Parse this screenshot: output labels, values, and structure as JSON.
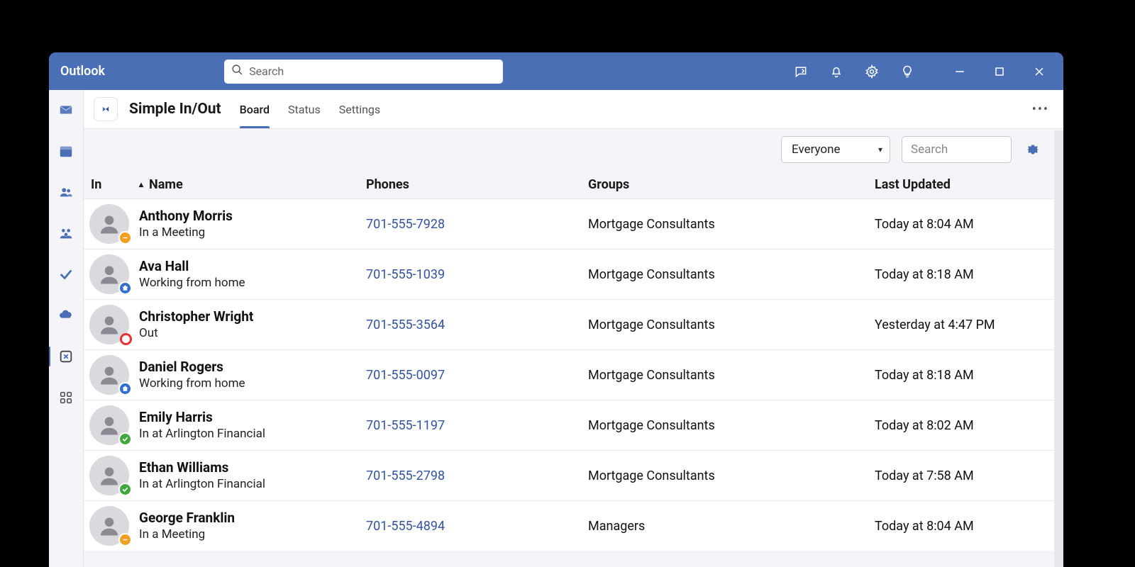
{
  "window": {
    "app_title": "Outlook",
    "search_placeholder": "Search"
  },
  "titlebar_icons": [
    "chat-icon",
    "bell-icon",
    "settings-gear-icon",
    "lightbulb-icon",
    "minimize-icon",
    "maximize-icon",
    "close-icon"
  ],
  "rail": [
    {
      "name": "mail-icon"
    },
    {
      "name": "calendar-icon"
    },
    {
      "name": "people-icon"
    },
    {
      "name": "groups-icon"
    },
    {
      "name": "todo-icon"
    },
    {
      "name": "onedrive-icon"
    },
    {
      "name": "simple-inout-icon",
      "active": true
    },
    {
      "name": "more-apps-icon"
    }
  ],
  "app": {
    "name": "Simple In/Out",
    "tabs": [
      {
        "id": "board",
        "label": "Board",
        "active": true
      },
      {
        "id": "status",
        "label": "Status",
        "active": false
      },
      {
        "id": "settings",
        "label": "Settings",
        "active": false
      }
    ]
  },
  "filters": {
    "group_selected": "Everyone",
    "search_placeholder": "Search"
  },
  "columns": {
    "in": "In",
    "name": "Name",
    "phones": "Phones",
    "groups": "Groups",
    "last_updated": "Last Updated",
    "sort": {
      "column": "name",
      "dir": "asc"
    }
  },
  "rows": [
    {
      "name": "Anthony Morris",
      "status_text": "In a Meeting",
      "status": "meeting",
      "phone": "701-555-7928",
      "group": "Mortgage Consultants",
      "updated": "Today at 8:04 AM"
    },
    {
      "name": "Ava Hall",
      "status_text": "Working from home",
      "status": "wfh",
      "phone": "701-555-1039",
      "group": "Mortgage Consultants",
      "updated": "Today at 8:18 AM"
    },
    {
      "name": "Christopher Wright",
      "status_text": "Out",
      "status": "out",
      "phone": "701-555-3564",
      "group": "Mortgage Consultants",
      "updated": "Yesterday at 4:47 PM"
    },
    {
      "name": "Daniel Rogers",
      "status_text": "Working from home",
      "status": "wfh",
      "phone": "701-555-0097",
      "group": "Mortgage Consultants",
      "updated": "Today at 8:18 AM"
    },
    {
      "name": "Emily Harris",
      "status_text": "In at Arlington Financial",
      "status": "in",
      "phone": "701-555-1197",
      "group": "Mortgage Consultants",
      "updated": "Today at 8:02 AM"
    },
    {
      "name": "Ethan Williams",
      "status_text": "In at Arlington Financial",
      "status": "in",
      "phone": "701-555-2798",
      "group": "Mortgage Consultants",
      "updated": "Today at 7:58 AM"
    },
    {
      "name": "George Franklin",
      "status_text": "In a Meeting",
      "status": "meeting",
      "phone": "701-555-4894",
      "group": "Managers",
      "updated": "Today at 8:04 AM"
    }
  ]
}
